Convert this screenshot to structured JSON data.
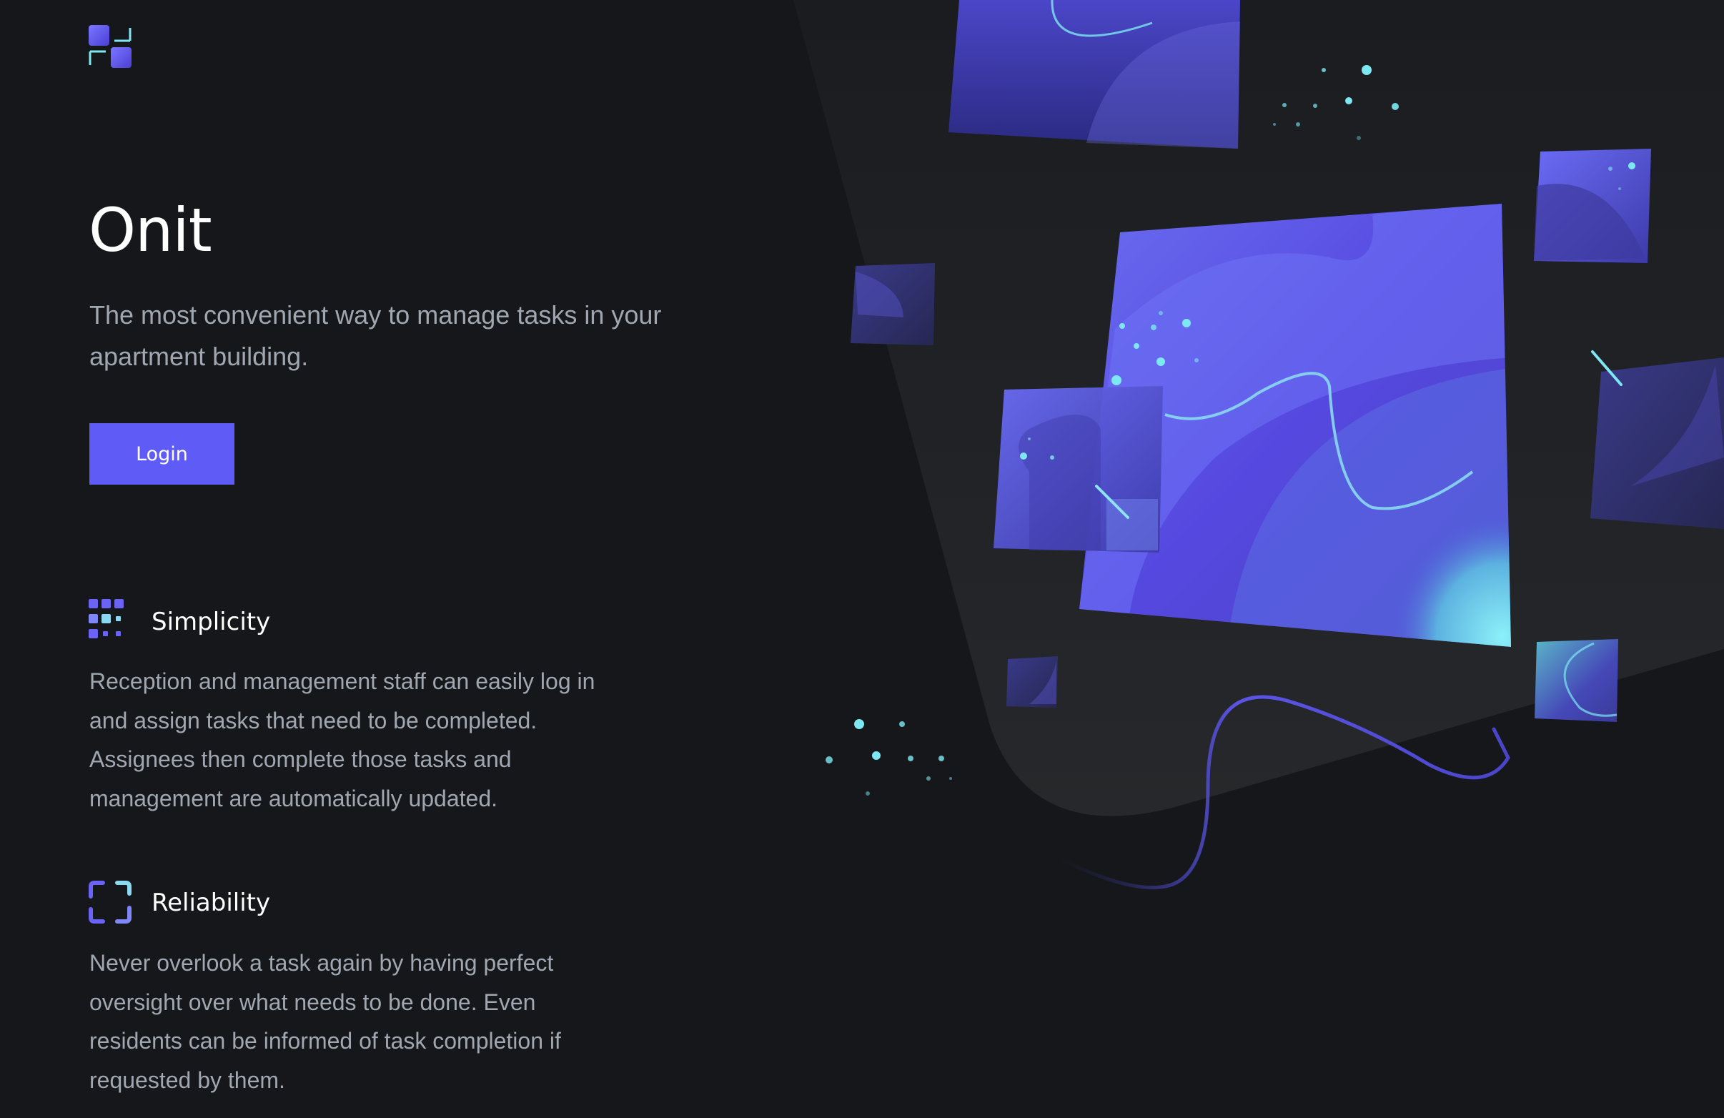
{
  "brand": {
    "name": "Onit",
    "logo_icon": "onit-logo-icon",
    "tagline": "The most convenient way to manage tasks in your apartment building."
  },
  "login": {
    "label": "Login"
  },
  "features": [
    {
      "icon": "dots-grid-icon",
      "title": "Simplicity",
      "text": "Reception and management staff can easily log in and assign tasks that need to be completed. Assignees then complete those tasks and management are automatically updated."
    },
    {
      "icon": "focus-frame-icon",
      "title": "Reliability",
      "text": "Never overlook a task again by having perfect oversight over what needs to be done. Even residents can be informed of task completion if requested by them."
    }
  ],
  "colors": {
    "background": "#15171a",
    "accent": "#5f5bf7",
    "teal": "#7ee8f2",
    "heading": "#ffffff",
    "body_text": "#a1a7b0"
  }
}
